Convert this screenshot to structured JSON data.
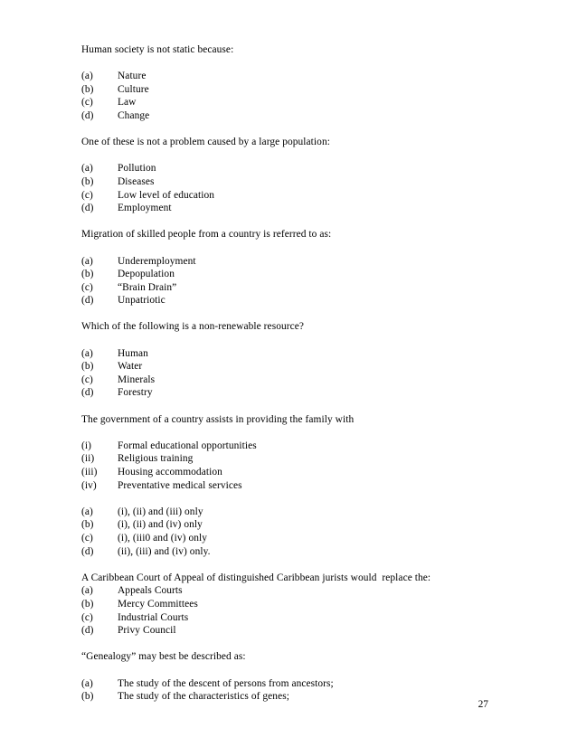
{
  "document": {
    "page_number": "27",
    "blocks": [
      {
        "stem": "Human society is not static because:",
        "stem_spaced": true,
        "options": [
          {
            "label": "(a)",
            "text": "Nature"
          },
          {
            "label": "(b)",
            "text": "Culture"
          },
          {
            "label": "(c)",
            "text": "Law"
          },
          {
            "label": "(d)",
            "text": "Change"
          }
        ]
      },
      {
        "stem": "One of these is not a problem caused by a large population:",
        "stem_spaced": true,
        "options": [
          {
            "label": "(a)",
            "text": "Pollution"
          },
          {
            "label": "(b)",
            "text": "Diseases"
          },
          {
            "label": "(c)",
            "text": "Low level of education"
          },
          {
            "label": "(d)",
            "text": "Employment"
          }
        ]
      },
      {
        "stem": "Migration of skilled people from a country is referred to as:",
        "stem_spaced": true,
        "options": [
          {
            "label": "(a)",
            "text": "Underemployment"
          },
          {
            "label": "(b)",
            "text": "Depopulation"
          },
          {
            "label": "(c)",
            "text": "“Brain Drain”"
          },
          {
            "label": "(d)",
            "text": "Unpatriotic"
          }
        ]
      },
      {
        "stem": "Which of the following is a non-renewable resource?",
        "stem_spaced": true,
        "options": [
          {
            "label": "(a)",
            "text": "Human"
          },
          {
            "label": "(b)",
            "text": "Water"
          },
          {
            "label": "(c)",
            "text": "Minerals"
          },
          {
            "label": "(d)",
            "text": "Forestry"
          }
        ]
      },
      {
        "stem": "The government of a country assists in providing the family with",
        "stem_spaced": true,
        "options": [
          {
            "label": "(i)",
            "text": "Formal educational opportunities"
          },
          {
            "label": "(ii)",
            "text": "Religious training"
          },
          {
            "label": "(iii)",
            "text": "Housing accommodation"
          },
          {
            "label": "(iv)",
            "text": "Preventative medical services"
          }
        ]
      },
      {
        "stem": "",
        "stem_spaced": false,
        "options": [
          {
            "label": "(a)",
            "text": "(i), (ii) and (iii) only"
          },
          {
            "label": "(b)",
            "text": "(i), (ii) and (iv) only"
          },
          {
            "label": "(c)",
            "text": "(i), (iii0 and (iv) only"
          },
          {
            "label": "(d)",
            "text": "(ii), (iii) and (iv) only."
          }
        ]
      },
      {
        "stem": "A Caribbean Court of Appeal of distinguished Caribbean jurists would  replace the:",
        "stem_spaced": false,
        "options": [
          {
            "label": "(a)",
            "text": "Appeals Courts"
          },
          {
            "label": "(b)",
            "text": "Mercy Committees"
          },
          {
            "label": "(c)",
            "text": "Industrial Courts"
          },
          {
            "label": "(d)",
            "text": "Privy Council"
          }
        ]
      },
      {
        "stem": "“Genealogy” may best be described as:",
        "stem_spaced": true,
        "options": [
          {
            "label": "(a)",
            "text": "The study of the descent of persons from ancestors;"
          },
          {
            "label": "(b)",
            "text": "The study of the characteristics of genes;"
          }
        ]
      }
    ]
  }
}
